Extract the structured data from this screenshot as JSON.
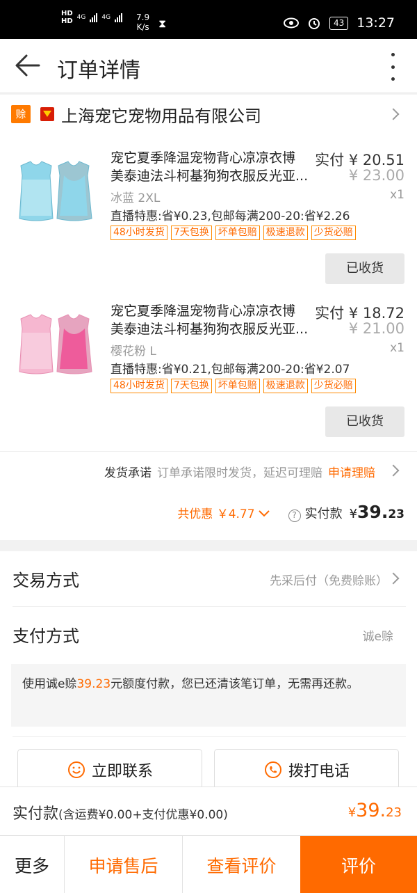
{
  "status_bar": {
    "network": [
      "HD",
      "HD",
      "4G",
      "4G"
    ],
    "speed_value": "7.9",
    "speed_unit": "K/s",
    "battery": "43",
    "time": "13:27"
  },
  "header": {
    "title": "订单详情"
  },
  "shop": {
    "badge": "赊",
    "name": "上海宠它宠物用品有限公司"
  },
  "items": [
    {
      "name_line1": "宠它夏季降温宠物背心凉凉衣博",
      "name_line2": "美泰迪法斗柯基狗狗衣服反光亚...",
      "paid_label": "实付",
      "paid_price": "¥ 20.51",
      "original_price": "¥ 23.00",
      "spec": "冰蓝 2XL",
      "qty": "x1",
      "promo": "直播特惠:省¥0.23,包邮每满200-20:省¥2.26",
      "tags": [
        "48小时发货",
        "7天包换",
        "坏单包赔",
        "极速退款",
        "少货必赔"
      ],
      "button": "已收货",
      "color": "#8fd6ea"
    },
    {
      "name_line1": "宠它夏季降温宠物背心凉凉衣博",
      "name_line2": "美泰迪法斗柯基狗狗衣服反光亚...",
      "paid_label": "实付",
      "paid_price": "¥ 18.72",
      "original_price": "¥ 21.00",
      "spec": "樱花粉 L",
      "qty": "x1",
      "promo": "直播特惠:省¥0.21,包邮每满200-20:省¥2.07",
      "tags": [
        "48小时发货",
        "7天包换",
        "坏单包赔",
        "极速退款",
        "少货必赔"
      ],
      "button": "已收货",
      "color": "#f6a9c9"
    }
  ],
  "promise": {
    "label": "发货承诺",
    "text": "订单承诺限时发货，延迟可理赔",
    "action": "申请理赔"
  },
  "summary": {
    "discount": "共优惠 ￥4.77",
    "paid_label": "实付款",
    "currency": "¥",
    "amount_int": "39.",
    "amount_dec": "23"
  },
  "trade": {
    "label": "交易方式",
    "value": "先采后付（免费赊账）"
  },
  "payment": {
    "label": "支付方式",
    "value": "诚e赊"
  },
  "note": {
    "before": "使用诚e赊",
    "amount": "39.23",
    "after": "元额度付款，您已还清该笔订单，无需再还款。"
  },
  "contact": {
    "chat": "立即联系",
    "call": "拨打电话"
  },
  "paybar": {
    "label": "实付款",
    "detail": "(含运费¥0.00+支付优惠¥0.00)",
    "currency": "¥",
    "amount_int": "39.",
    "amount_dec": "23"
  },
  "actions": {
    "more": "更多",
    "after_sales": "申请售后",
    "view_review": "查看评价",
    "review": "评价"
  },
  "colors": {
    "accent": "#ff6a00",
    "tag_border": "#ff8a00"
  }
}
